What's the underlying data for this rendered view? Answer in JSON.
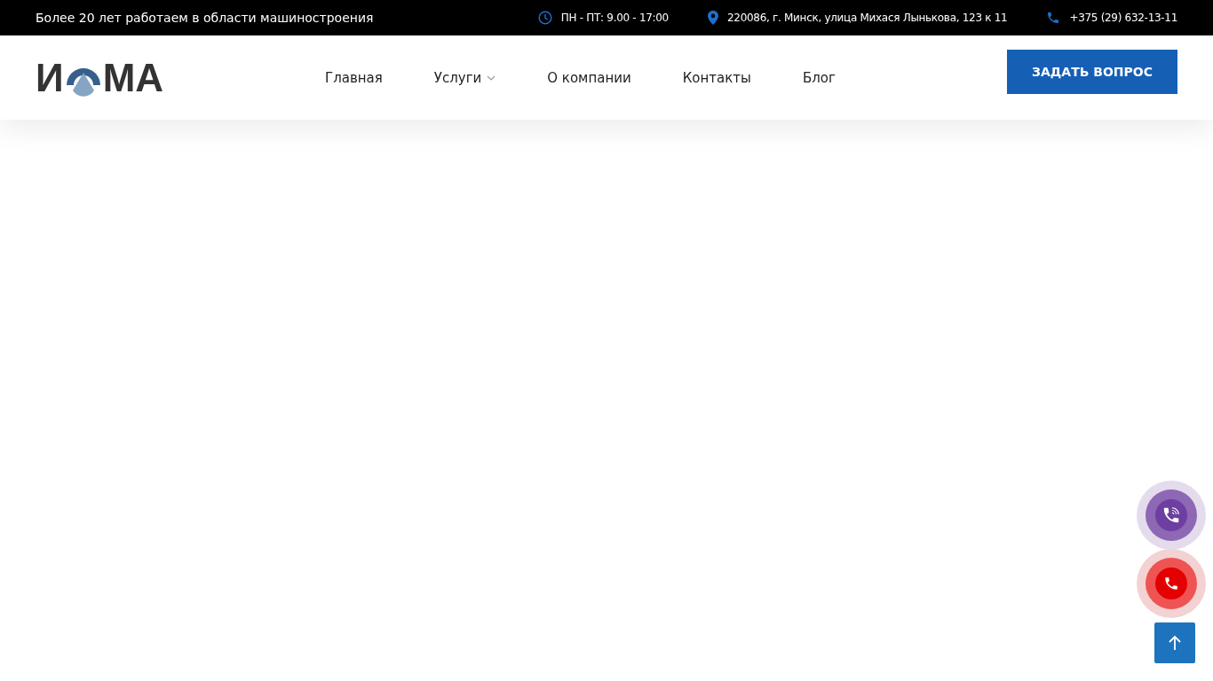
{
  "top_bar": {
    "tagline": "Более 20 лет работаем в области машиностроения",
    "hours": "ПН - ПТ: 9.00 - 17:00",
    "address": "220086, г. Минск, улица Михася Лынькова, 123 к 11",
    "phone": "+375 (29) 632-13-11"
  },
  "header": {
    "logo": {
      "before": "И",
      "after": "МА"
    },
    "nav": [
      {
        "label": "Главная",
        "dropdown": false
      },
      {
        "label": "Услуги",
        "dropdown": true
      },
      {
        "label": "О компании",
        "dropdown": false
      },
      {
        "label": "Контакты",
        "dropdown": false
      },
      {
        "label": "Блог",
        "dropdown": false
      }
    ],
    "cta": "ЗАДАТЬ ВОПРОС"
  }
}
